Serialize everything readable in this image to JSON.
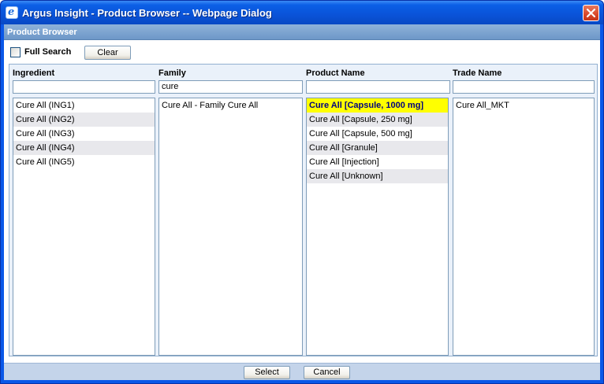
{
  "window": {
    "title": "Argus Insight - Product Browser -- Webpage Dialog"
  },
  "header": {
    "title": "Product Browser"
  },
  "toolbar": {
    "full_search_label": "Full Search",
    "full_search_checked": false,
    "clear_label": "Clear"
  },
  "columns": {
    "ingredient": {
      "label": "Ingredient",
      "filter": "",
      "items": [
        "Cure All (ING1)",
        "Cure All (ING2)",
        "Cure All (ING3)",
        "Cure All (ING4)",
        "Cure All (ING5)"
      ]
    },
    "family": {
      "label": "Family",
      "filter": "cure",
      "items": [
        "Cure All - Family Cure All"
      ]
    },
    "product": {
      "label": "Product Name",
      "filter": "",
      "items": [
        "Cure All [Capsule, 1000 mg]",
        "Cure All [Capsule, 250 mg]",
        "Cure All [Capsule, 500 mg]",
        "Cure All [Granule]",
        "Cure All [Injection]",
        "Cure All [Unknown]"
      ],
      "selected_index": 0
    },
    "trade": {
      "label": "Trade Name",
      "filter": "",
      "items": [
        "Cure All_MKT"
      ]
    }
  },
  "footer": {
    "select_label": "Select",
    "cancel_label": "Cancel"
  },
  "colors": {
    "title_bar": "#0a53d8",
    "header_bar": "#7aa0cf",
    "selection": "#ffff00",
    "alt_row": "#e8e8ec"
  }
}
